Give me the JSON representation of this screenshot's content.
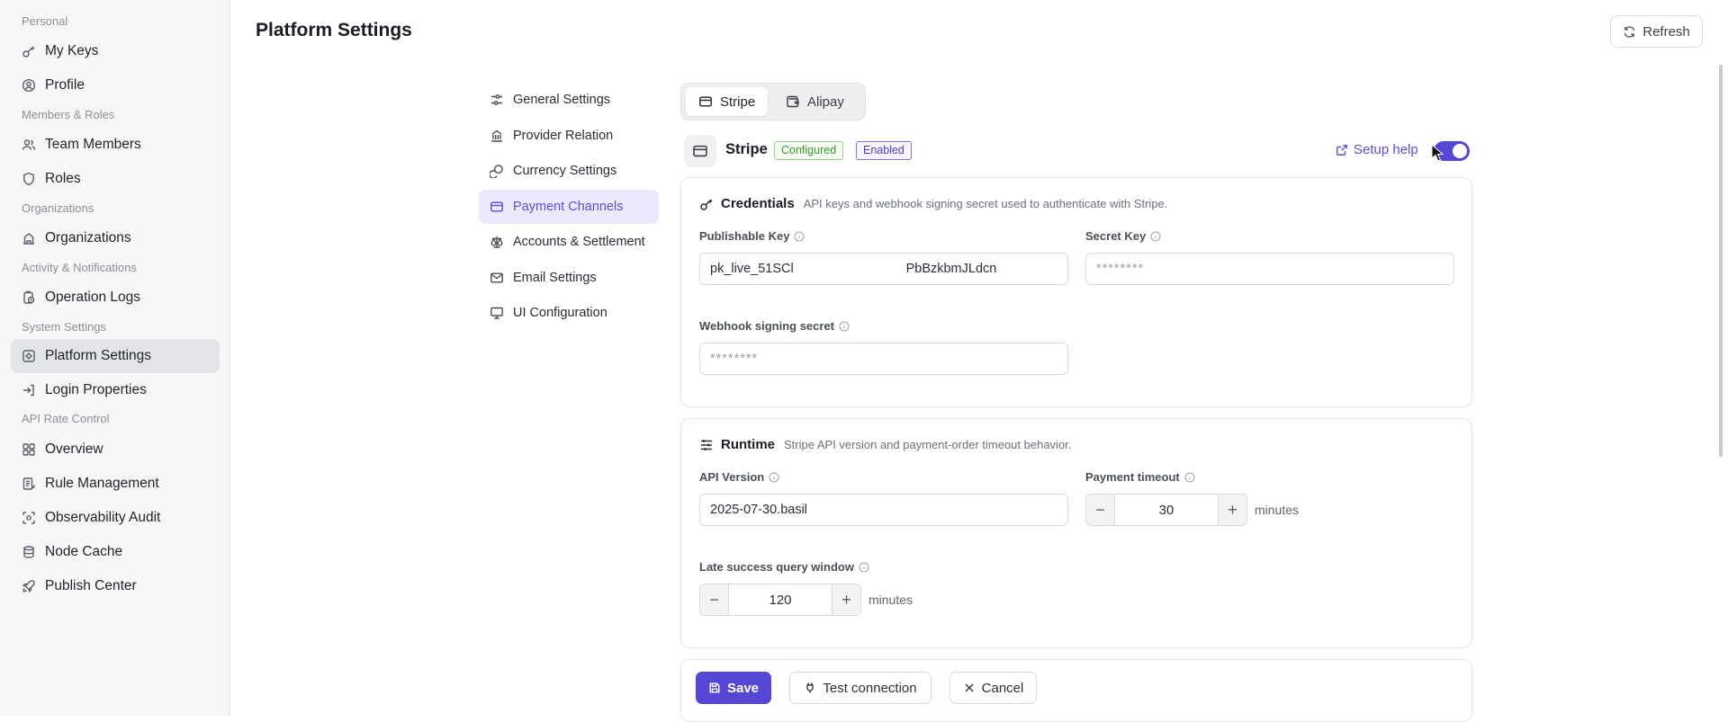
{
  "sidebar": {
    "sections": {
      "personal": "Personal",
      "members_roles": "Members & Roles",
      "organizations": "Organizations",
      "activity": "Activity & Notifications",
      "system": "System Settings",
      "api_rate": "API Rate Control"
    },
    "items": {
      "my_keys": "My Keys",
      "profile": "Profile",
      "team_members": "Team Members",
      "roles": "Roles",
      "organizations": "Organizations",
      "operation_logs": "Operation Logs",
      "platform_settings": "Platform Settings",
      "login_properties": "Login Properties",
      "overview": "Overview",
      "rule_management": "Rule Management",
      "observability_audit": "Observability Audit",
      "node_cache": "Node Cache",
      "publish_center": "Publish Center"
    },
    "active": "platform_settings"
  },
  "header": {
    "title": "Platform Settings",
    "refresh_label": "Refresh"
  },
  "settings_nav": {
    "general": "General Settings",
    "provider_relation": "Provider Relation",
    "currency": "Currency Settings",
    "payment_channels": "Payment Channels",
    "accounts_settlement": "Accounts & Settlement",
    "email": "Email Settings",
    "ui_config": "UI Configuration",
    "active": "payment_channels"
  },
  "tabs": {
    "stripe": "Stripe",
    "alipay": "Alipay",
    "active": "stripe"
  },
  "provider": {
    "name": "Stripe",
    "badge_configured": "Configured",
    "badge_enabled": "Enabled",
    "setup_help": "Setup help",
    "enabled": true
  },
  "credentials": {
    "title": "Credentials",
    "description": "API keys and webhook signing secret used to authenticate with Stripe.",
    "publishable_key_label": "Publishable Key",
    "publishable_key_value": "pk_live_51SCl                               PbBzkbmJLdcn",
    "secret_key_label": "Secret Key",
    "secret_key_placeholder": "********",
    "webhook_secret_label": "Webhook signing secret",
    "webhook_secret_placeholder": "********"
  },
  "runtime": {
    "title": "Runtime",
    "description": "Stripe API version and payment-order timeout behavior.",
    "api_version_label": "API Version",
    "api_version_value": "2025-07-30.basil",
    "payment_timeout_label": "Payment timeout",
    "payment_timeout_value": "30",
    "payment_timeout_unit": "minutes",
    "late_query_label": "Late success query window",
    "late_query_value": "120",
    "late_query_unit": "minutes"
  },
  "actions": {
    "save": "Save",
    "test_connection": "Test connection",
    "cancel": "Cancel"
  },
  "colors": {
    "accent": "#5547d3",
    "active_nav_bg": "#ebe9fb",
    "configured_green": "#3d9a2f"
  }
}
